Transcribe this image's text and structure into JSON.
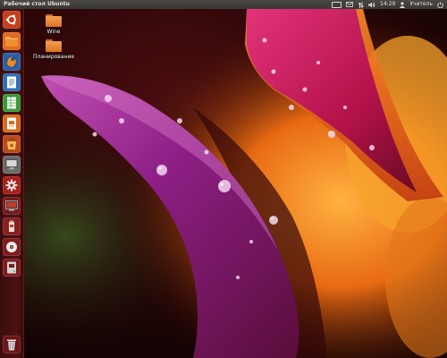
{
  "top_panel": {
    "title": "Рабочий стол Ubuntu",
    "clock": "14:29",
    "user": "Учитель"
  },
  "desktop": {
    "icons": [
      {
        "label": "Wine",
        "icon": "folder-icon"
      },
      {
        "label": "Планирование",
        "icon": "folder-icon"
      }
    ]
  },
  "launcher": {
    "items": [
      {
        "name": "dash-home",
        "icon": "ubuntu-logo-icon"
      },
      {
        "name": "home-folder",
        "icon": "folder-icon"
      },
      {
        "name": "firefox",
        "icon": "firefox-icon"
      },
      {
        "name": "libreoffice-writer",
        "icon": "document-icon"
      },
      {
        "name": "libreoffice-calc",
        "icon": "spreadsheet-icon"
      },
      {
        "name": "libreoffice-impress",
        "icon": "presentation-icon"
      },
      {
        "name": "ubuntu-software-center",
        "icon": "shopping-bag-icon"
      },
      {
        "name": "remote-desktop",
        "icon": "monitor-icon"
      },
      {
        "name": "system-settings",
        "icon": "gear-icon"
      },
      {
        "name": "screen-app",
        "icon": "screen-icon"
      },
      {
        "name": "package-app",
        "icon": "package-icon"
      },
      {
        "name": "cd-drive",
        "icon": "cd-icon"
      },
      {
        "name": "disk-drive",
        "icon": "drive-icon"
      },
      {
        "name": "trash",
        "icon": "trash-icon"
      }
    ]
  },
  "colors": {
    "panel": "#3f3d3a",
    "launcher": "#4c1214",
    "folder": "#e8852f",
    "wallpaper_petal": "#8a1f7a",
    "wallpaper_orange": "#f08a1c"
  }
}
